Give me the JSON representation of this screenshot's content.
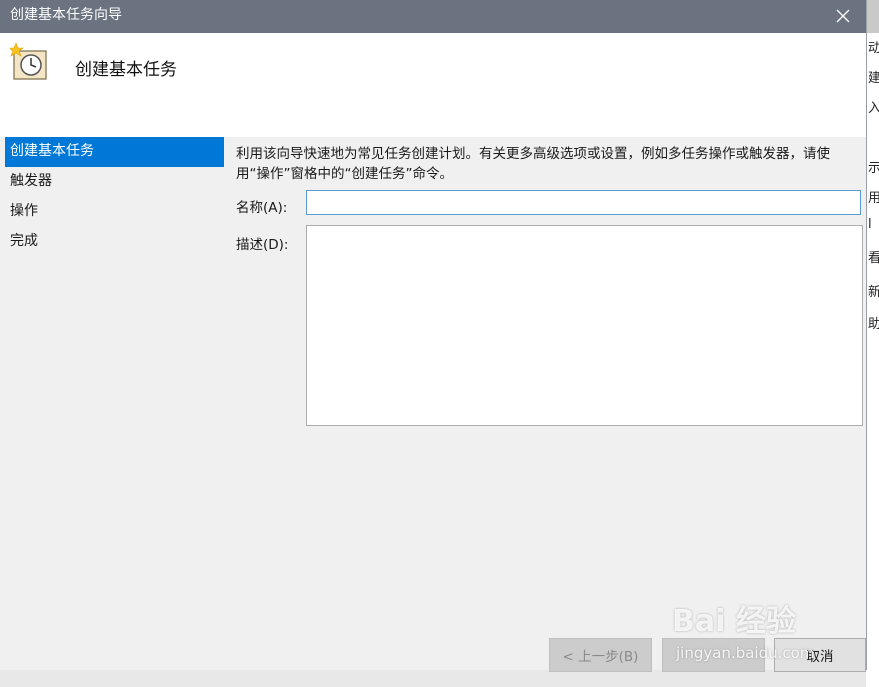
{
  "window": {
    "title": "创建基本任务向导",
    "close_icon": "close-icon"
  },
  "header": {
    "heading": "创建基本任务",
    "icon": "scheduled-task-clock-icon"
  },
  "steps": [
    {
      "label": "创建基本任务",
      "active": true
    },
    {
      "label": "触发器",
      "active": false
    },
    {
      "label": "操作",
      "active": false
    },
    {
      "label": "完成",
      "active": false
    }
  ],
  "content": {
    "description": "利用该向导快速地为常见任务创建计划。有关更多高级选项或设置，例如多任务操作或触发器，请使用“操作”窗格中的“创建任务”命令。",
    "name_label": "名称(A):",
    "name_value": "",
    "desc_label": "描述(D):",
    "desc_value": ""
  },
  "buttons": {
    "back": "< 上一步(B)",
    "next": "",
    "cancel": "取消"
  },
  "watermark": {
    "main": "Bai 经验",
    "sub": "jingyan.baidu.com"
  },
  "background_app": {
    "side_chars": [
      "动",
      "建",
      "入",
      "示",
      "用",
      "l",
      "看",
      "新",
      "助"
    ]
  },
  "colors": {
    "titlebar": "#6b7280",
    "selected": "#0078d7"
  }
}
